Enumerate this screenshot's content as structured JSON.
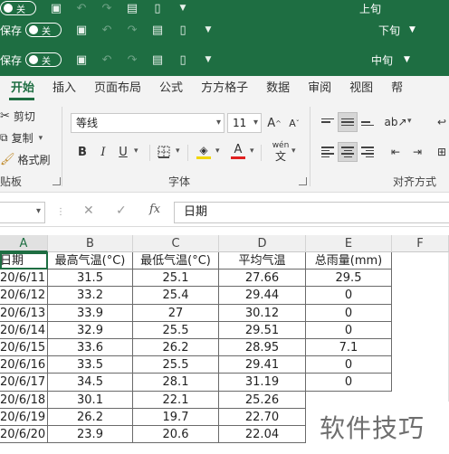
{
  "quick_bars": [
    {
      "label": "",
      "toggle": "关",
      "title": "上旬"
    },
    {
      "label": "保存",
      "toggle": "关",
      "title": "下旬"
    },
    {
      "label": "保存",
      "toggle": "关",
      "title": "中旬"
    }
  ],
  "tabs": [
    "开始",
    "插入",
    "页面布局",
    "公式",
    "方方格子",
    "数据",
    "审阅",
    "视图",
    "帮"
  ],
  "clipboard": {
    "cut": "剪切",
    "copy": "复制",
    "format_painter": "格式刷",
    "group": "贴板"
  },
  "font": {
    "name": "等线",
    "size": "11",
    "grow": "A",
    "shrink": "A",
    "bold": "B",
    "italic": "I",
    "underline": "U",
    "color_letter": "A",
    "wen": "wén",
    "wen_char": "文",
    "group": "字体",
    "highlight_color": "#f2d600",
    "font_color": "#e02020"
  },
  "alignment": {
    "group": "对齐方式"
  },
  "formula_bar": {
    "content": "日期",
    "fx": "fx"
  },
  "columns": [
    "A",
    "B",
    "C",
    "D",
    "E",
    "F"
  ],
  "headers": [
    "日期",
    "最高气温(°C)",
    "最低气温(°C)",
    "平均气温",
    "总雨量(mm)"
  ],
  "rows": [
    [
      "20/6/11",
      "31.5",
      "25.1",
      "27.66",
      "29.5"
    ],
    [
      "20/6/12",
      "33.2",
      "25.4",
      "29.44",
      "0"
    ],
    [
      "20/6/13",
      "33.9",
      "27",
      "30.12",
      "0"
    ],
    [
      "20/6/14",
      "32.9",
      "25.5",
      "29.51",
      "0"
    ],
    [
      "20/6/15",
      "33.6",
      "26.2",
      "28.95",
      "7.1"
    ],
    [
      "20/6/16",
      "33.5",
      "25.5",
      "29.41",
      "0"
    ],
    [
      "20/6/17",
      "34.5",
      "28.1",
      "31.19",
      "0"
    ],
    [
      "20/6/18",
      "30.1",
      "22.1",
      "25.26",
      ""
    ],
    [
      "20/6/19",
      "26.2",
      "19.7",
      "22.70",
      ""
    ],
    [
      "20/6/20",
      "23.9",
      "20.6",
      "22.04",
      ""
    ]
  ],
  "watermark": "软件技巧",
  "colors": {
    "brand_green": "#1e6e42",
    "ribbon_bg": "#f3f3f3"
  }
}
